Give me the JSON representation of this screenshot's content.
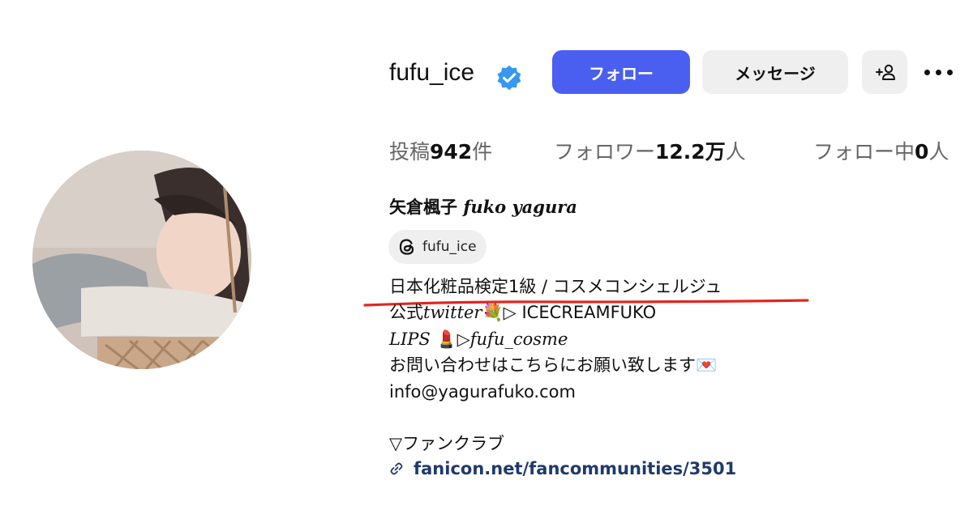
{
  "profile": {
    "username": "fufu_ice",
    "follow_label": "フォロー",
    "message_label": "メッセージ",
    "colors": {
      "follow_button": "#4a5ff0",
      "verified": "#3897f0",
      "annotation_underline": "#e0271f"
    }
  },
  "stats": {
    "posts_label": "投稿",
    "posts_value": "942",
    "posts_unit": "件",
    "followers_label": "フォロワー",
    "followers_value": "12.2万",
    "followers_unit": "人",
    "following_label": "フォロー中",
    "following_value": "0",
    "following_unit": "人"
  },
  "bio": {
    "full_name_jp": "矢倉楓子",
    "full_name_en": "fuko yagura",
    "threads_handle": "fufu_ice",
    "line1": "日本化粧品検定1級 / コスメコンシェルジュ",
    "line2_prefix": "公式",
    "line2_twitter": "twitter",
    "line2_emoji": "💐",
    "line2_rest": "▷ ICECREAMFUKO",
    "line3_lips": "LIPS",
    "line3_emoji": "💄",
    "line3_rest": "▷fufu_cosme",
    "line4": "お問い合わせはこちらにお願い致します",
    "line4_emoji": "💌",
    "line5": "info@yagurafuko.com",
    "line7": "▽ファンクラブ",
    "link": "fanicon.net/fancommunities/3501"
  }
}
